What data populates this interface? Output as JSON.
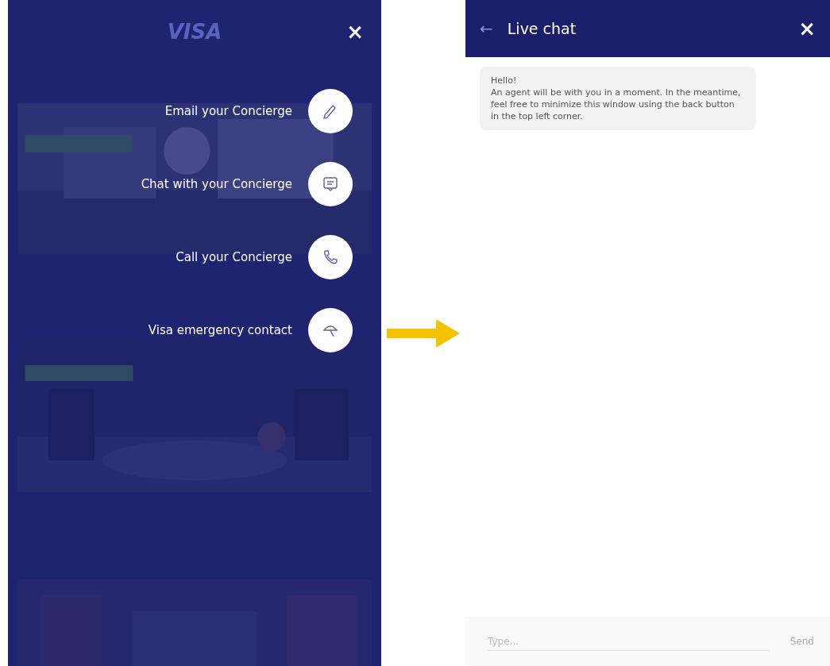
{
  "menu_screen": {
    "header": {
      "logo": "VISA",
      "close": "×"
    },
    "menu": [
      {
        "label": "Email your Concierge"
      },
      {
        "label": "Chat with your Concierge"
      },
      {
        "label": "Call your Concierge"
      },
      {
        "label": "Visa emergency contact"
      }
    ]
  },
  "chat_screen": {
    "header": {
      "back": "←",
      "title": "Live chat",
      "close": "×"
    },
    "messages": [
      {
        "greeting": "Hello!",
        "text": "An agent will be with you in a moment. In the meantime, feel free to minimize this window using the back button in the top left corner."
      }
    ],
    "composer": {
      "placeholder": "Type...",
      "send": "Send"
    }
  }
}
